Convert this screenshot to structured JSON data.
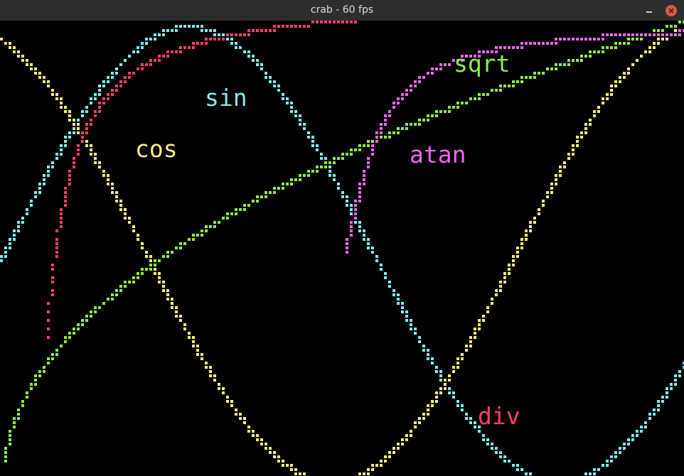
{
  "window": {
    "title": "crab - 60 fps"
  },
  "titlebar_icons": {
    "minimize": "minimize-icon",
    "close": "close-icon"
  },
  "colors": {
    "titlebar": "#2e2e2e",
    "title_text": "#dcdcdc",
    "close_button": "#e05a44",
    "background": "#000000"
  },
  "chart_data": {
    "type": "line",
    "series": [
      {
        "name": "sin",
        "color": "#80eeee"
      },
      {
        "name": "cos",
        "color": "#fff07a"
      },
      {
        "name": "sqrt",
        "color": "#90ee40"
      },
      {
        "name": "atan",
        "color": "#ee66ee"
      },
      {
        "name": "div",
        "color": "#ff4068"
      }
    ]
  }
}
